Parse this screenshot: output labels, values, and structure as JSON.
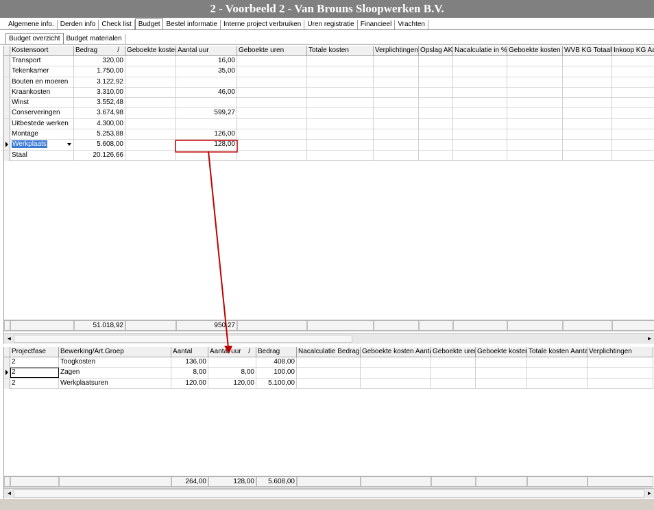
{
  "window": {
    "title": "2 - Voorbeeld 2 - Van Brouns Sloopwerken B.V."
  },
  "main_tabs": [
    "Algemene info.",
    "Derden info",
    "Check list",
    "Budget",
    "Bestel informatie",
    "Interne project verbruiken",
    "Uren registratie",
    "Financieel",
    "Vrachten"
  ],
  "main_active": 3,
  "sub_tabs": [
    "Budget overzicht",
    "Budget materialen"
  ],
  "sub_active": 0,
  "top_grid": {
    "sort_indicator": "/",
    "columns": [
      "Kostensoort",
      "Bedrag",
      "Geboekte kosten",
      "Aantal uur",
      "Geboekte uren",
      "Totale kosten",
      "Verplichtingen",
      "Opslag AK.",
      "Nacalculatie in %",
      "Geboekte kosten in",
      "WVB KG Totaal",
      "Inkoop KG Aan"
    ],
    "rows": [
      {
        "name": "Transport",
        "bedrag": "320,00",
        "aantal_uur": "16,00"
      },
      {
        "name": "Tekenkamer",
        "bedrag": "1.750,00",
        "aantal_uur": "35,00"
      },
      {
        "name": "Bouten en moeren",
        "bedrag": "3.122,92",
        "aantal_uur": ""
      },
      {
        "name": "Kraankosten",
        "bedrag": "3.310,00",
        "aantal_uur": "46,00"
      },
      {
        "name": "Winst",
        "bedrag": "3.552,48",
        "aantal_uur": ""
      },
      {
        "name": "Conserveringen",
        "bedrag": "3.674,98",
        "aantal_uur": "599,27"
      },
      {
        "name": "Uitbestede werken",
        "bedrag": "4.300,00",
        "aantal_uur": ""
      },
      {
        "name": "Montage",
        "bedrag": "5.253,88",
        "aantal_uur": "126,00"
      },
      {
        "name": "Werkplaats",
        "bedrag": "5.608,00",
        "aantal_uur": "128,00"
      },
      {
        "name": "Staal",
        "bedrag": "20.126,66",
        "aantal_uur": ""
      }
    ],
    "current_row": 8,
    "totals": {
      "bedrag": "51.018,92",
      "aantal_uur": "950,27"
    }
  },
  "bottom_grid": {
    "sort_indicator": "/",
    "columns": [
      "Projectfase",
      "Bewerking/Art.Groep",
      "Aantal",
      "Aantal uur",
      "Bedrag",
      "Nacalculatie Bedrag i",
      "Geboekte kosten Aantal",
      "Geboekte uren",
      "Geboekte kosten",
      "Totale kosten Aantal",
      "Verplichtingen"
    ],
    "rows": [
      {
        "fase": "2",
        "groep": "Toogkosten",
        "aantal": "136,00",
        "aantal_uur": "",
        "bedrag": "408,00"
      },
      {
        "fase": "2",
        "groep": "Zagen",
        "aantal": "8,00",
        "aantal_uur": "8,00",
        "bedrag": "100,00"
      },
      {
        "fase": "2",
        "groep": "Werkplaatsuren",
        "aantal": "120,00",
        "aantal_uur": "120,00",
        "bedrag": "5.100,00"
      }
    ],
    "current_row": 1,
    "totals": {
      "aantal": "264,00",
      "aantal_uur": "128,00",
      "bedrag": "5.608,00"
    }
  },
  "scrollbar": {
    "left_arrow": "◄",
    "right_arrow": "►"
  },
  "annotation": {
    "color": "#c00000"
  }
}
